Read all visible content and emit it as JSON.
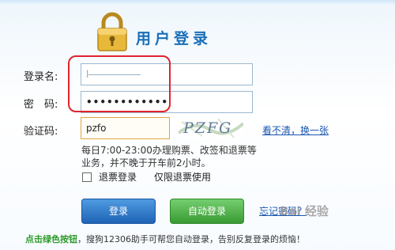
{
  "header": {
    "title": "用户登录"
  },
  "form": {
    "username_label": "登录名:",
    "username_value": "l——————",
    "password_label": "密　码:",
    "password_value": "••••••••••••",
    "captcha_label": "验证码:",
    "captcha_value": "pzfo",
    "captcha_image_text": "PZFG",
    "cant_see_link": "看不清，换一张",
    "hint_text": "每日7:00-23:00办理购票、改签和退票等业务，并不晚于开车前2小时。",
    "refund_checkbox_label": "退票登录",
    "refund_note": "仅限退票使用"
  },
  "buttons": {
    "login": "登录",
    "auto_login": "自动登录",
    "forgot": "忘记密码？"
  },
  "footer": {
    "green_text": "点击绿色按钮",
    "rest_text": "，搜狗12306助手可帮您自动登录，告别反复登录的烦恼！"
  },
  "watermark": "Bai 经验",
  "colors": {
    "title": "#1a6fb8",
    "highlight": "#e0242f",
    "login_button": "#2f74c6",
    "auto_button": "#4caf46",
    "link": "#1a56b0"
  },
  "icons": {
    "lock": "padlock-icon"
  }
}
